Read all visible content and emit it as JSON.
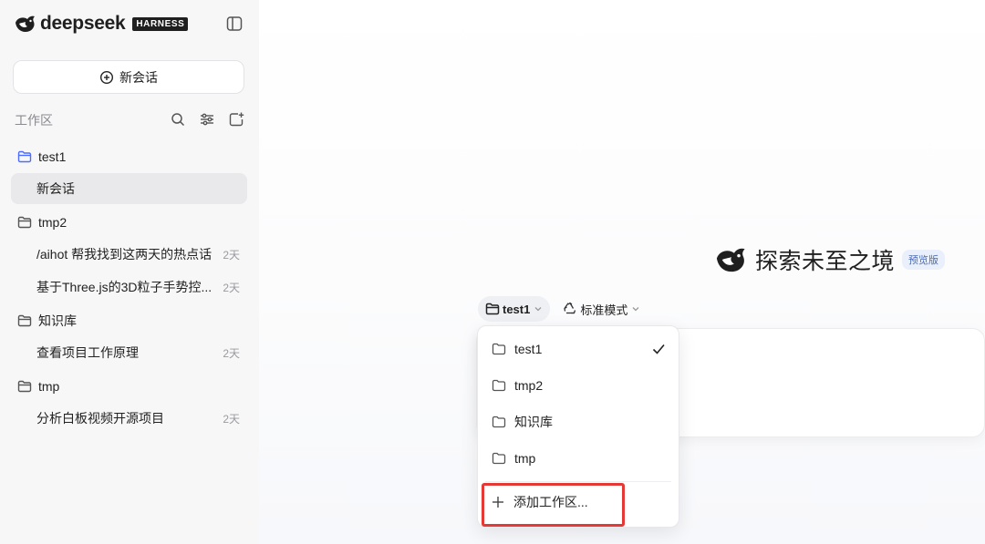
{
  "app": {
    "brand_name": "deepseek",
    "brand_badge": "HARNESS",
    "accent_color": "#4d6bfe"
  },
  "sidebar": {
    "new_chat_label": "新会话",
    "workspace_title": "工作区",
    "folders": [
      {
        "name": "test1",
        "chats": [
          {
            "title": "新会话",
            "time": ""
          }
        ]
      },
      {
        "name": "tmp2",
        "chats": [
          {
            "title": "/aihot 帮我找到这两天的热点话",
            "time": "2天"
          },
          {
            "title": "基于Three.js的3D粒子手势控...",
            "time": "2天"
          }
        ]
      },
      {
        "name": "知识库",
        "chats": [
          {
            "title": "查看项目工作原理",
            "time": "2天"
          }
        ]
      },
      {
        "name": "tmp",
        "chats": [
          {
            "title": "分析白板视频开源项目",
            "time": "2天"
          }
        ]
      }
    ]
  },
  "main": {
    "hero_title": "探索未至之境",
    "hero_badge": "预览版",
    "workspace_selector": "test1",
    "mode_selector": "标准模式"
  },
  "dropdown": {
    "items": [
      "test1",
      "tmp2",
      "知识库",
      "tmp"
    ],
    "selected": "test1",
    "add_label": "添加工作区..."
  }
}
